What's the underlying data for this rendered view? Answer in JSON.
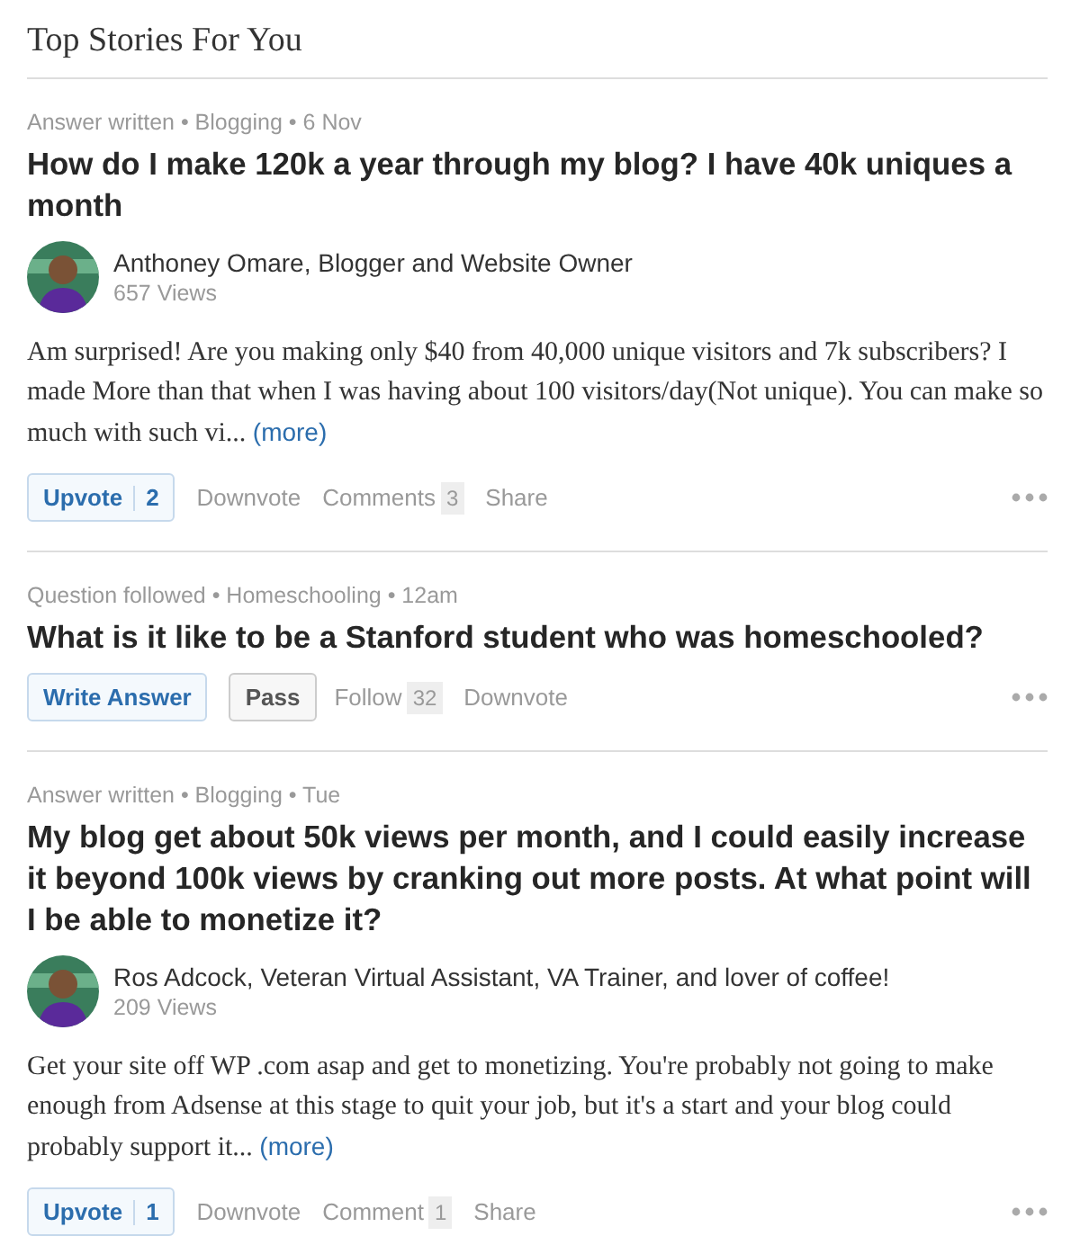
{
  "header": {
    "title": "Top Stories For You"
  },
  "stories": [
    {
      "kind": "answer",
      "meta": "Answer written • Blogging • 6 Nov",
      "headline": "How do I make 120k a year through my blog? I have 40k uniques a month",
      "author": {
        "name": "Anthoney Omare, Blogger and Website Owner",
        "views": "657 Views"
      },
      "body": "Am surprised! Are you making only $40 from 40,000 unique visitors and 7k subscribers? I made More than that when I was having about 100 visitors/day(Not unique). You can make so much with such vi...",
      "more": "(more)",
      "actions": [
        {
          "kind": "primary",
          "label": "Upvote",
          "count": "2"
        },
        {
          "kind": "link",
          "label": "Downvote"
        },
        {
          "kind": "link",
          "label": "Comments",
          "count": "3"
        },
        {
          "kind": "link",
          "label": "Share"
        }
      ]
    },
    {
      "kind": "question",
      "meta": "Question followed • Homeschooling • 12am",
      "headline": "What is it like to be a Stanford student who was homeschooled?",
      "actions": [
        {
          "kind": "primary",
          "label": "Write Answer"
        },
        {
          "kind": "secondary",
          "label": "Pass"
        },
        {
          "kind": "link",
          "label": "Follow",
          "count": "32"
        },
        {
          "kind": "link",
          "label": "Downvote"
        }
      ]
    },
    {
      "kind": "answer",
      "meta": "Answer written • Blogging • Tue",
      "headline": "My blog get about 50k views per month, and I could easily increase it beyond 100k views by cranking out more posts. At what point will I be able to monetize it?",
      "author": {
        "name": "Ros Adcock, Veteran Virtual Assistant, VA Trainer, and lover of coffee!",
        "views": "209 Views"
      },
      "body": "Get your site off WP .com asap and get to monetizing.  You're probably not going to make enough from Adsense at this stage to quit your job, but it's a start and your blog could probably support it...",
      "more": "(more)",
      "actions": [
        {
          "kind": "primary",
          "label": "Upvote",
          "count": "1"
        },
        {
          "kind": "link",
          "label": "Downvote"
        },
        {
          "kind": "link",
          "label": "Comment",
          "count": "1"
        },
        {
          "kind": "link",
          "label": "Share"
        }
      ]
    }
  ]
}
